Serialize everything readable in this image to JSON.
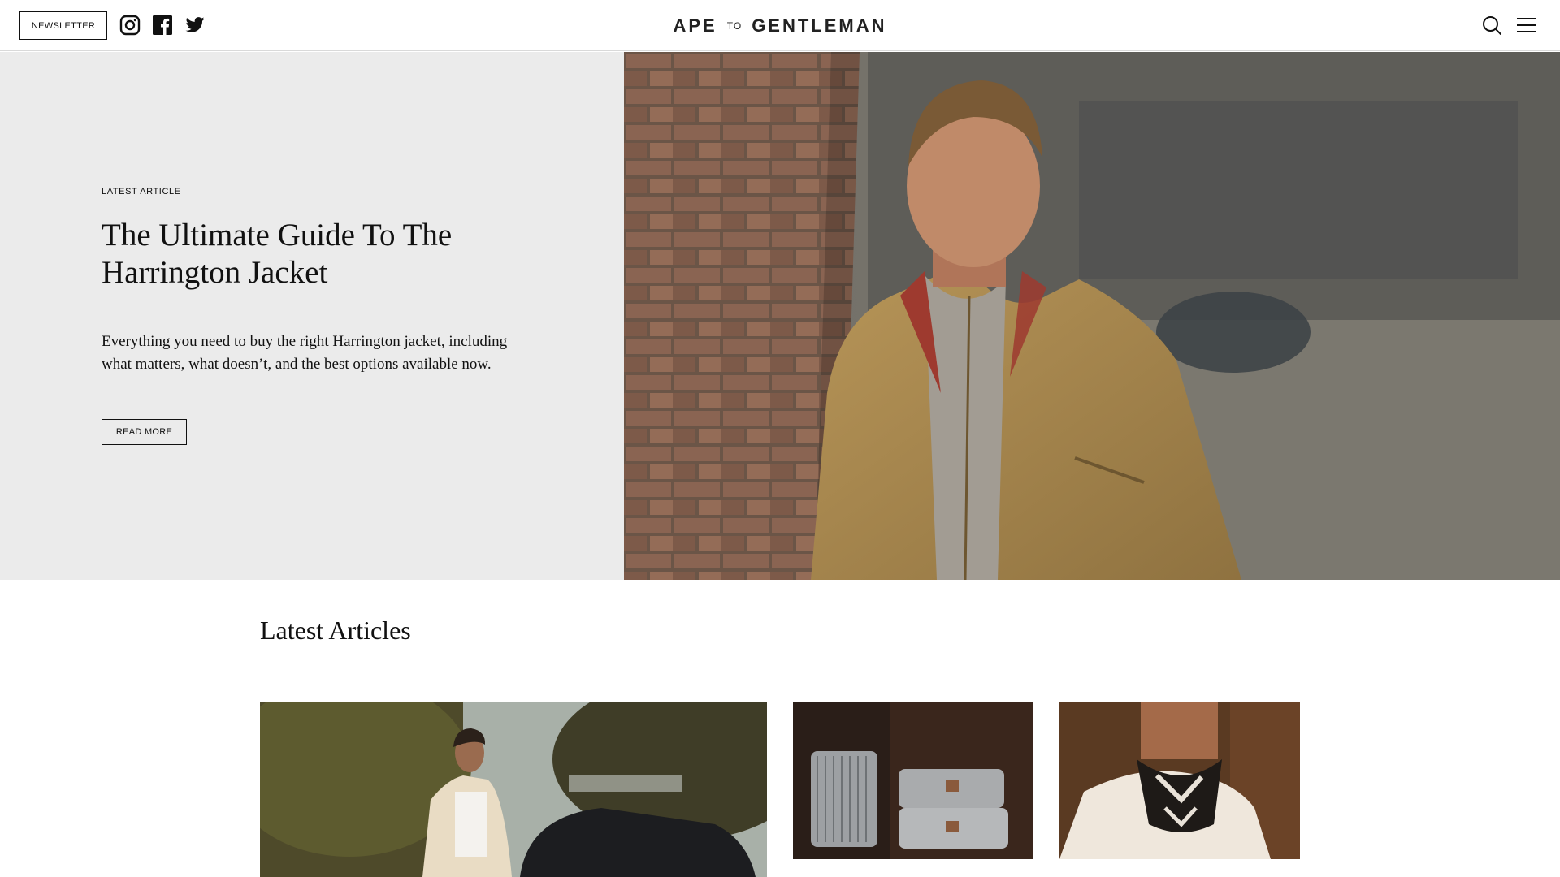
{
  "header": {
    "newsletter_label": "NEWSLETTER",
    "logo": {
      "part1": "APE",
      "part2": "TO",
      "part3": "GENTLEMAN"
    },
    "social_icons": [
      "instagram-icon",
      "facebook-icon",
      "twitter-icon"
    ],
    "right_icons": [
      "search-icon",
      "menu-icon"
    ]
  },
  "hero": {
    "eyebrow": "LATEST ARTICLE",
    "title": "The Ultimate Guide To The Harrington Jacket",
    "description": "Everything you need to buy the right Harrington jacket, including what matters, what doesn’t, and the best options available now.",
    "button_label": "READ MORE",
    "background_color": "#ebebeb"
  },
  "latest": {
    "title": "Latest Articles"
  },
  "colors": {
    "text": "#111111",
    "rule": "#d8d8d8",
    "jacket": "#a88a4e"
  }
}
